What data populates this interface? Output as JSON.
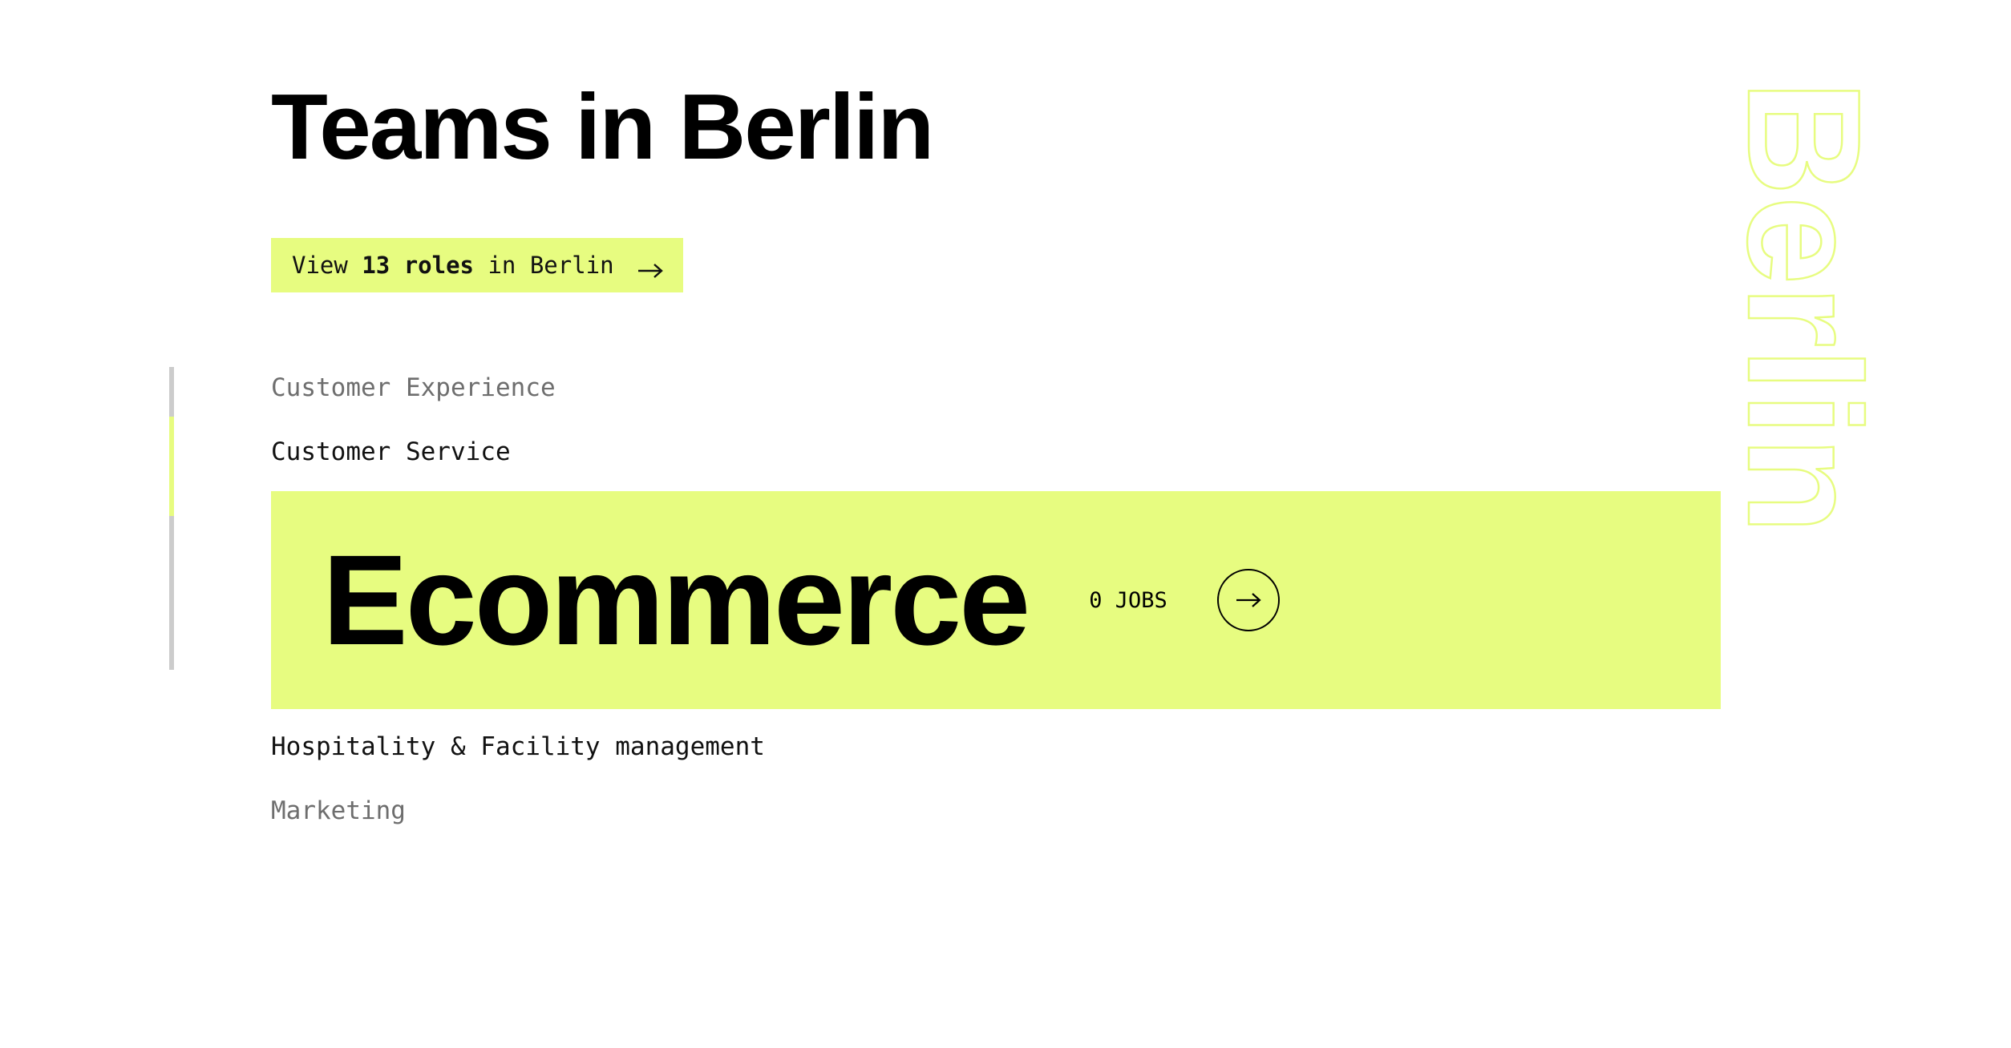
{
  "colors": {
    "accent": "#e7fc80",
    "text": "#000000",
    "muted_text": "#6e6e6e",
    "track": "#cccccc",
    "background": "#ffffff"
  },
  "header": {
    "title": "Teams in Berlin"
  },
  "view_roles": {
    "prefix": "View ",
    "count_label": "13 roles",
    "suffix": " in Berlin",
    "icon": "arrow-right-icon"
  },
  "teams": {
    "items": [
      {
        "label": "Customer Experience"
      },
      {
        "label": "Customer Service"
      },
      {
        "label": "Ecommerce"
      },
      {
        "label": "Hospitality & Facility management"
      },
      {
        "label": "Marketing"
      }
    ],
    "active": {
      "name": "Ecommerce",
      "jobs": "0 JOBS",
      "icon": "arrow-right-circle-icon"
    }
  },
  "city_watermark": "Berlin"
}
